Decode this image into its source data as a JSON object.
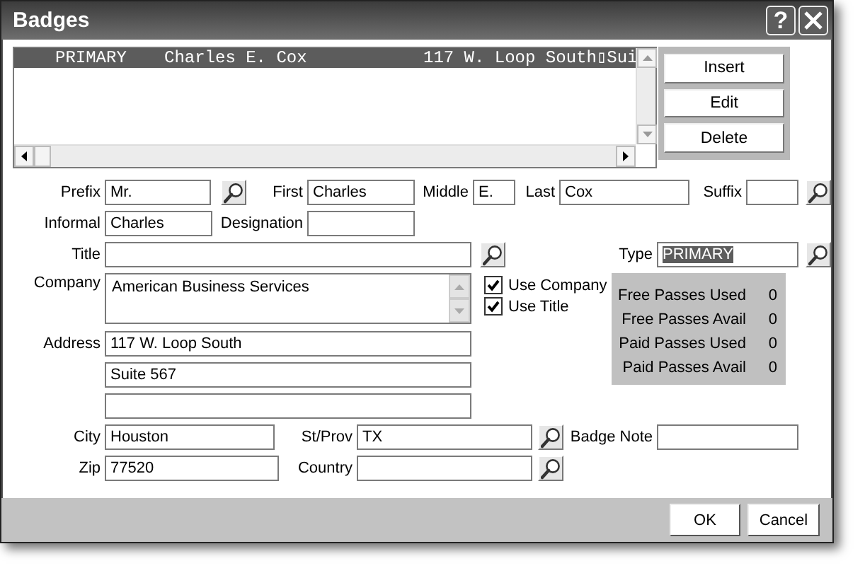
{
  "window": {
    "title": "Badges",
    "help_button": "?"
  },
  "list": {
    "rows": [
      {
        "cells": [
          "PRIMARY",
          "Charles E. Cox",
          "117 W. Loop South▯Sui"
        ],
        "selected": true
      }
    ]
  },
  "list_buttons": [
    "Insert",
    "Edit",
    "Delete"
  ],
  "top_rows": [
    [
      {
        "label": "Prefix",
        "value": "Mr.",
        "lookup": true
      },
      {
        "label": "First",
        "value": "Charles",
        "lookup": false
      },
      {
        "label": "Middle",
        "value": "E.",
        "lookup": false
      },
      {
        "label": "Last",
        "value": "Cox",
        "lookup": false
      },
      {
        "label": "Suffix",
        "lookup": true
      }
    ],
    [
      {
        "label": "Informal",
        "value": "Charles",
        "lookup": false
      },
      {
        "label": "Designation",
        "lookup": false
      }
    ],
    [
      {
        "label": "Title",
        "lookup": true
      },
      {
        "label": "Type",
        "value": "PRIMARY",
        "lookup": true,
        "highlighted": true
      }
    ]
  ],
  "company": {
    "label": "Company",
    "value": "American Business Services"
  },
  "options": [
    {
      "label": "Use Company",
      "checked": true
    },
    {
      "label": "Use Title",
      "checked": true
    }
  ],
  "passes": [
    {
      "label": "Free Passes Used",
      "value": "0"
    },
    {
      "label": "Free Passes Avail",
      "value": "0"
    },
    {
      "label": "Paid Passes Used",
      "value": "0"
    },
    {
      "label": "Paid Passes Avail",
      "value": "0"
    }
  ],
  "address": {
    "label": "Address",
    "lines": [
      "117 W. Loop South",
      "Suite 567"
    ]
  },
  "bottom_rows": [
    [
      {
        "label": "City",
        "value": "Houston",
        "lookup": false
      },
      {
        "label": "St/Prov",
        "value": "TX",
        "lookup": true
      },
      {
        "label": "Badge Note",
        "lookup": false
      }
    ],
    [
      {
        "label": "Zip",
        "value": "77520",
        "lookup": false
      },
      {
        "label": "Country",
        "lookup": true
      }
    ]
  ],
  "footer_buttons": [
    "OK",
    "Cancel"
  ]
}
